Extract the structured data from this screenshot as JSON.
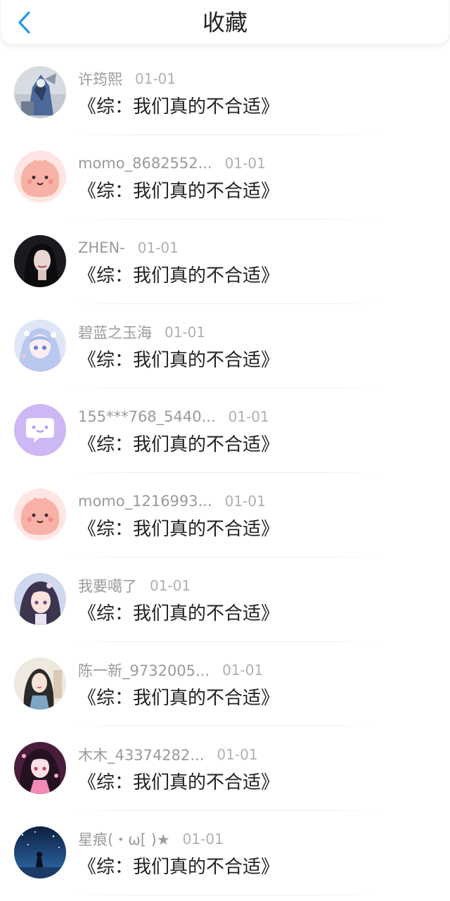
{
  "header": {
    "title": "收藏",
    "back_icon": "chevron-left-icon",
    "accent_color": "#1e9be8"
  },
  "items": [
    {
      "username": "许筠熙",
      "date": "01-01",
      "book": "《综：我们真的不合适》",
      "avatar": "armored-character-avatar"
    },
    {
      "username": "momo_8682552...",
      "date": "01-01",
      "book": "《综：我们真的不合适》",
      "avatar": "pink-blob-avatar"
    },
    {
      "username": "ZHEN-",
      "date": "01-01",
      "book": "《综：我们真的不合适》",
      "avatar": "dark-portrait-avatar"
    },
    {
      "username": "碧蓝之玉海",
      "date": "01-01",
      "book": "《综：我们真的不合适》",
      "avatar": "anime-girl-blue-avatar"
    },
    {
      "username": "155***768_5440...",
      "date": "01-01",
      "book": "《综：我们真的不合适》",
      "avatar": "purple-chat-bubble-avatar"
    },
    {
      "username": "momo_1216993...",
      "date": "01-01",
      "book": "《综：我们真的不合适》",
      "avatar": "pink-blob-avatar"
    },
    {
      "username": "我要噶了",
      "date": "01-01",
      "book": "《综：我们真的不合适》",
      "avatar": "anime-girl-avatar"
    },
    {
      "username": "陈一新_9732005...",
      "date": "01-01",
      "book": "《综：我们真的不合适》",
      "avatar": "painted-lady-avatar"
    },
    {
      "username": "木木_43374282...",
      "date": "01-01",
      "book": "《综：我们真的不合适》",
      "avatar": "anime-girl-pink-avatar"
    },
    {
      "username": "星痕(・ω[ )★",
      "date": "01-01",
      "book": "《综：我们真的不合适》",
      "avatar": "night-sky-figure-avatar"
    }
  ]
}
